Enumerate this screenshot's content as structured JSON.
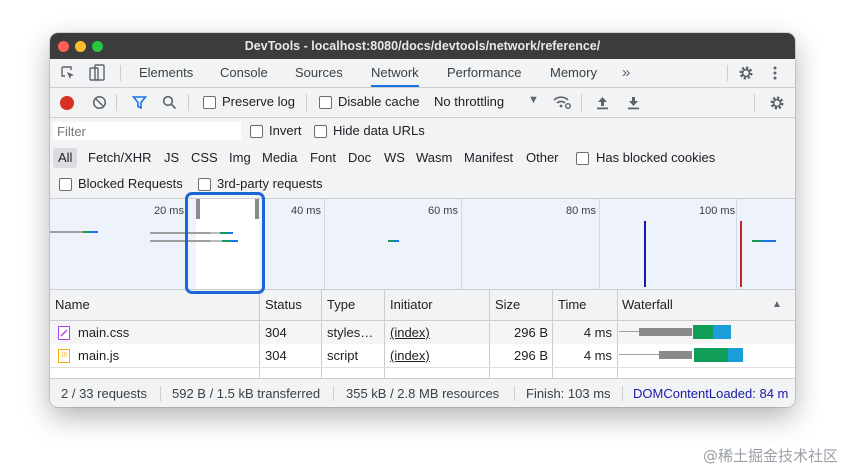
{
  "window": {
    "title": "DevTools - localhost:8080/docs/devtools/network/reference/"
  },
  "tabs": [
    {
      "label": "Elements"
    },
    {
      "label": "Console"
    },
    {
      "label": "Sources"
    },
    {
      "label": "Network"
    },
    {
      "label": "Performance"
    },
    {
      "label": "Memory"
    }
  ],
  "toolbar": {
    "preserve_log": "Preserve log",
    "disable_cache": "Disable cache",
    "throttling": "No throttling"
  },
  "filter": {
    "placeholder": "Filter",
    "invert": "Invert",
    "hide_data_urls": "Hide data URLs",
    "types": [
      "All",
      "Fetch/XHR",
      "JS",
      "CSS",
      "Img",
      "Media",
      "Font",
      "Doc",
      "WS",
      "Wasm",
      "Manifest",
      "Other"
    ],
    "has_blocked_cookies": "Has blocked cookies",
    "blocked_requests": "Blocked Requests",
    "third_party": "3rd-party requests"
  },
  "overview": {
    "ticks": [
      "20 ms",
      "40 ms",
      "60 ms",
      "80 ms",
      "100 ms"
    ]
  },
  "table": {
    "columns": [
      "Name",
      "Status",
      "Type",
      "Initiator",
      "Size",
      "Time",
      "Waterfall"
    ],
    "rows": [
      {
        "name": "main.css",
        "status": "304",
        "type": "styles…",
        "initiator": "(index)",
        "size": "296 B",
        "time": "4 ms"
      },
      {
        "name": "main.js",
        "status": "304",
        "type": "script",
        "initiator": "(index)",
        "size": "296 B",
        "time": "4 ms"
      }
    ]
  },
  "footer": {
    "requests": "2 / 33 requests",
    "transferred": "592 B / 1.5 kB transferred",
    "resources": "355 kB / 2.8 MB resources",
    "finish": "Finish: 103 ms",
    "dcl": "DOMContentLoaded: 84 m"
  },
  "watermark": "@稀土掘金技术社区",
  "colors": {
    "accent": "#1a73e8",
    "record": "#d93025",
    "dcl": "#1a1aa6",
    "highlight_box": "#1a66d6"
  }
}
